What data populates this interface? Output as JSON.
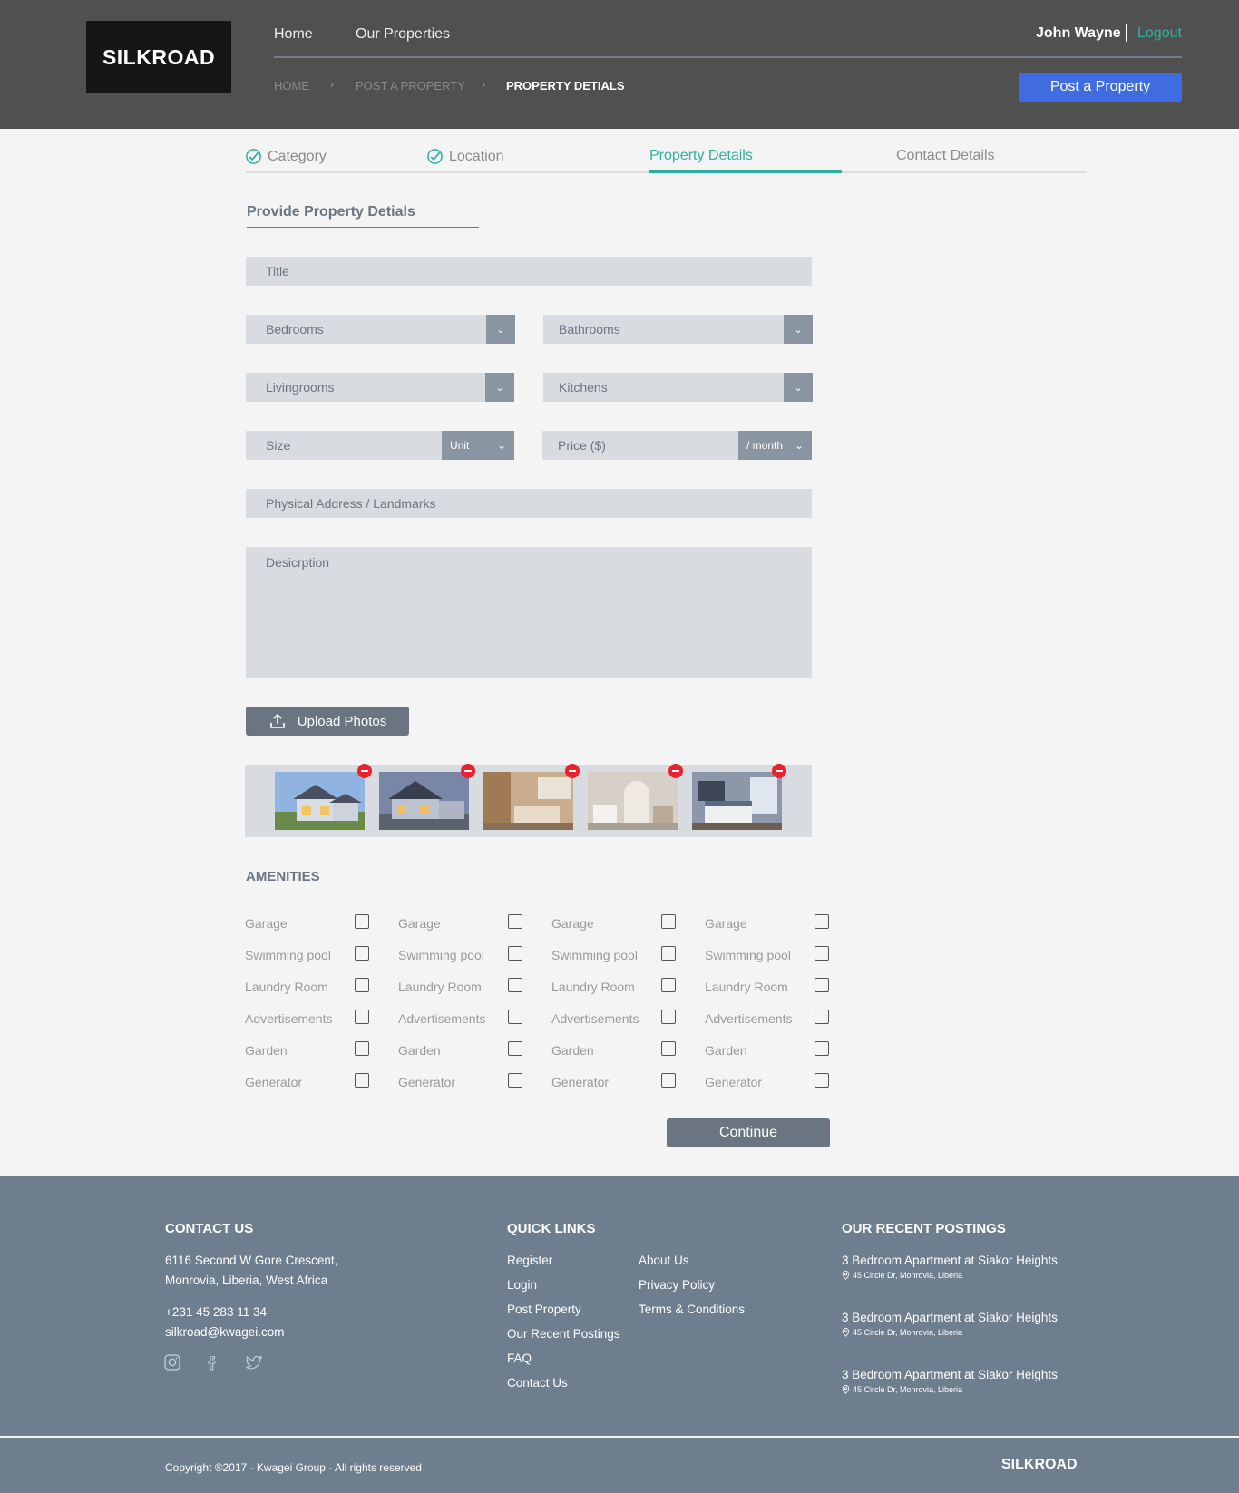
{
  "header": {
    "logo": "SILKROAD",
    "nav": [
      "Home",
      "Our Properties"
    ],
    "breadcrumb": [
      "HOME",
      "POST A PROPERTY",
      "PROPERTY DETIALS"
    ],
    "user_name": "John Wayne",
    "logout": "Logout",
    "post_button": "Post a Property"
  },
  "steps": [
    {
      "label": "Category",
      "done": true
    },
    {
      "label": "Location",
      "done": true
    },
    {
      "label": "Property Details",
      "active": true
    },
    {
      "label": "Contact Details"
    }
  ],
  "form": {
    "title": "Provide Property Detials",
    "fields": {
      "title": "Title",
      "bedrooms": "Bedrooms",
      "bathrooms": "Bathrooms",
      "livingrooms": "Livingrooms",
      "kitchens": "Kitchens",
      "size": "Size",
      "unit": "Unit",
      "price": "Price ($)",
      "period": "/ month",
      "address": "Physical Address / Landmarks",
      "description": "Desicrption"
    },
    "upload_button": "Upload Photos",
    "photos": [
      "house-exterior-1",
      "house-exterior-2",
      "kitchen",
      "bathroom",
      "bedroom"
    ],
    "amenities_title": "AMENITIES",
    "amenities": [
      "Garage",
      "Swimming pool",
      "Laundry Room",
      "Advertisements",
      "Garden",
      "Generator"
    ],
    "continue_button": "Continue"
  },
  "footer": {
    "contact": {
      "heading": "CONTACT US",
      "address_line1": "6116 Second W Gore Crescent,",
      "address_line2": "Monrovia, Liberia, West Africa",
      "phone": "+231 45 283 11 34",
      "email": "silkroad@kwagei.com",
      "social_icons": [
        "instagram-icon",
        "facebook-icon",
        "twitter-icon"
      ]
    },
    "quick_links": {
      "heading": "QUICK LINKS",
      "col1": [
        "Register",
        "Login",
        "Post Property",
        "Our Recent Postings",
        "FAQ",
        "Contact Us"
      ],
      "col2": [
        "About Us",
        "Privacy Policy",
        "Terms & Conditions"
      ]
    },
    "recent": {
      "heading": "OUR RECENT POSTINGS",
      "items": [
        {
          "title": "3 Bedroom Apartment at Siakor Heights",
          "location": "45 Circle Dr, Monrovia, Liberia"
        },
        {
          "title": "3 Bedroom Apartment at Siakor Heights",
          "location": "45 Circle Dr, Monrovia, Liberia"
        },
        {
          "title": "3 Bedroom Apartment at Siakor Heights",
          "location": "45 Circle Dr, Monrovia, Liberia"
        }
      ]
    },
    "copyright": "Copyright ®2017 - Kwagei Group - All rights reserved",
    "logo": "SILKROAD"
  },
  "colors": {
    "accent": "#2eb0a0",
    "primary_button": "#3f6ce0",
    "header_bg": "#505050",
    "footer_bg": "#6f7e8f",
    "remove": "#e8232e"
  }
}
